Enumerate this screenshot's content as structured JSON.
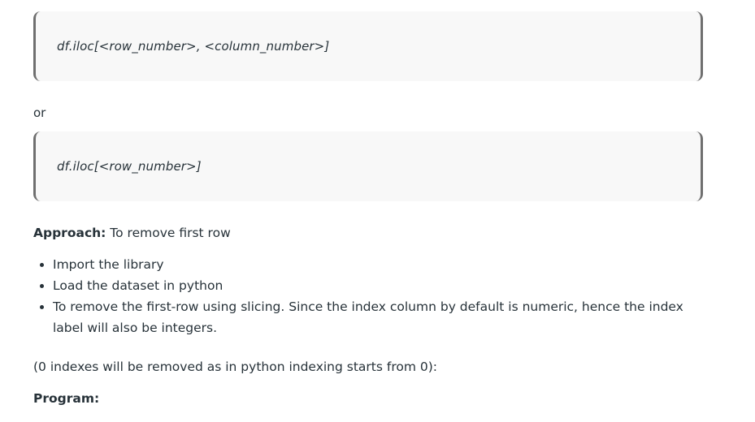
{
  "code_blocks": [
    {
      "code": "df.iloc[<row_number>, <column_number>]"
    },
    {
      "code": "df.iloc[<row_number>]"
    }
  ],
  "or_text": "or",
  "approach": {
    "label": "Approach:",
    "text": " To remove first row"
  },
  "steps": [
    "Import the library",
    "Load the dataset in python",
    "To remove the first-row using slicing. Since the index column by default is numeric, hence the index label will also be integers."
  ],
  "note": "(0 indexes will be removed as in python indexing starts from 0):",
  "program_label": "Program:"
}
